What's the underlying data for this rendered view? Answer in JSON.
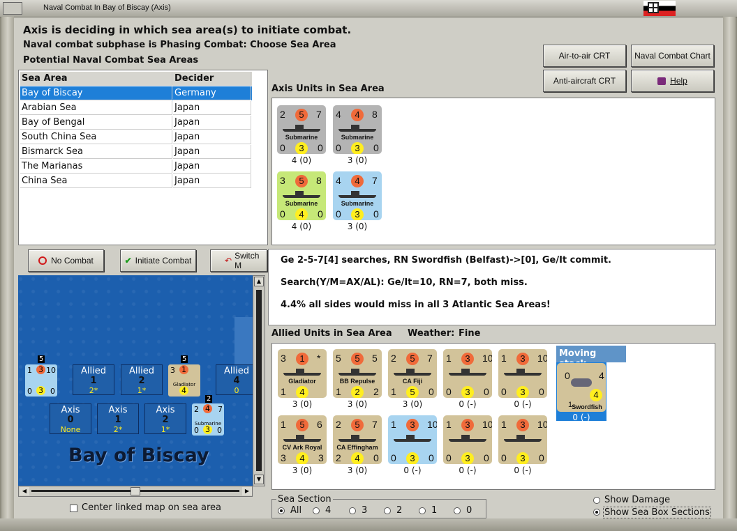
{
  "window": {
    "title": "Naval Combat In Bay of Biscay (Axis)"
  },
  "header": {
    "line1": "Axis is deciding in which sea area(s) to initiate combat.",
    "line2": "Naval combat subphase is Phasing Combat: Choose Sea Area",
    "line3": "Potential Naval Combat Sea Areas"
  },
  "buttons": {
    "air_crt": "Air-to-air CRT",
    "naval_chart": "Naval Combat Chart",
    "aa_crt": "Anti-aircraft CRT",
    "help": "Help",
    "no_combat": "No Combat",
    "initiate": "Initiate Combat",
    "switch": "Switch M"
  },
  "sea_table": {
    "headers": [
      "Sea Area",
      "Decider"
    ],
    "rows": [
      [
        "Bay of Biscay",
        "Germany"
      ],
      [
        "Arabian Sea",
        "Japan"
      ],
      [
        "Bay of Bengal",
        "Japan"
      ],
      [
        "South China Sea",
        "Japan"
      ],
      [
        "Bismarck Sea",
        "Japan"
      ],
      [
        "The Marianas",
        "Japan"
      ],
      [
        "China Sea",
        "Japan"
      ]
    ]
  },
  "axis_panel": {
    "label": "Axis Units in Sea Area",
    "units": [
      {
        "a": "2",
        "b": "5",
        "c": "7",
        "type": "Submarine",
        "d": "0",
        "e": "3",
        "f": "0",
        "under": "4 (0)",
        "color": "#b4b4b4"
      },
      {
        "a": "4",
        "b": "4",
        "c": "8",
        "type": "Submarine",
        "d": "0",
        "e": "3",
        "f": "0",
        "under": "3 (0)",
        "color": "#b4b4b4"
      },
      {
        "a": "3",
        "b": "5",
        "c": "8",
        "type": "Submarine",
        "d": "0",
        "e": "4",
        "f": "0",
        "under": "4 (0)",
        "color": "#c6e878"
      },
      {
        "a": "4",
        "b": "4",
        "c": "7",
        "type": "Submarine",
        "d": "0",
        "e": "3",
        "f": "0",
        "under": "3 (0)",
        "color": "#a8d4f0"
      }
    ]
  },
  "log": {
    "line1": "Ge 2-5-7[4] searches, RN Swordfish (Belfast)->[0], Ge/It commit.",
    "line2": "Search(Y/M=AX/AL):  Ge/It=10, RN=7, both miss.",
    "line3": "4.4% all sides would miss in all 3 Atlantic Sea Areas!"
  },
  "allied_panel": {
    "label": "Allied Units in Sea Area",
    "weather_label": "Weather:",
    "weather": "Fine",
    "units": [
      {
        "a": "3",
        "b": "1",
        "c": "*",
        "type": "Gladiator",
        "d": "1",
        "e": "4",
        "f": "",
        "under": "3 (0)",
        "color": "#d2c39a"
      },
      {
        "a": "5",
        "b": "5",
        "c": "5",
        "type": "BB Repulse",
        "d": "1",
        "e": "2",
        "f": "2",
        "under": "3 (0)",
        "color": "#d2c39a"
      },
      {
        "a": "2",
        "b": "5",
        "c": "7",
        "type": "CA Fiji",
        "d": "1",
        "e": "5",
        "f": "0",
        "under": "3 (0)",
        "color": "#d2c39a"
      },
      {
        "a": "1",
        "b": "3",
        "c": "10",
        "type": "",
        "d": "0",
        "e": "3",
        "f": "0",
        "under": "0 (-)",
        "color": "#d2c39a"
      },
      {
        "a": "1",
        "b": "3",
        "c": "10",
        "type": "",
        "d": "0",
        "e": "3",
        "f": "0",
        "under": "0 (-)",
        "color": "#d2c39a"
      },
      {
        "a": "1",
        "b": "5",
        "c": "6",
        "type": "CV Ark Royal",
        "d": "3",
        "e": "4",
        "f": "3",
        "under": "3 (0)",
        "color": "#d2c39a"
      },
      {
        "a": "2",
        "b": "5",
        "c": "7",
        "type": "CA Effingham",
        "d": "2",
        "e": "4",
        "f": "0",
        "under": "3 (0)",
        "color": "#d2c39a"
      },
      {
        "a": "1",
        "b": "3",
        "c": "10",
        "type": "",
        "d": "0",
        "e": "3",
        "f": "0",
        "under": "0 (-)",
        "color": "#a8d4f0"
      },
      {
        "a": "1",
        "b": "3",
        "c": "10",
        "type": "",
        "d": "0",
        "e": "3",
        "f": "0",
        "under": "0 (-)",
        "color": "#d2c39a"
      },
      {
        "a": "1",
        "b": "3",
        "c": "10",
        "type": "",
        "d": "0",
        "e": "3",
        "f": "0",
        "under": "0 (-)",
        "color": "#d2c39a"
      }
    ]
  },
  "moving_stack": {
    "label": "Moving stack",
    "unit_a": "0",
    "unit_b": "4",
    "unit_c": "4",
    "unit_d": "1",
    "type": "Swordfish",
    "under": "0 (-)"
  },
  "map": {
    "title": "Bay of Biscay",
    "allied_boxes": [
      {
        "label": "Allied",
        "num": "1",
        "sub": "2*"
      },
      {
        "label": "Allied",
        "num": "2",
        "sub": "1*"
      },
      {
        "label": "Allied",
        "num": "4",
        "sub": "0"
      }
    ],
    "axis_boxes": [
      {
        "label": "Axis",
        "num": "0",
        "sub": "None"
      },
      {
        "label": "Axis",
        "num": "1",
        "sub": "2*"
      },
      {
        "label": "Axis",
        "num": "2",
        "sub": "1*"
      }
    ],
    "stack_counts": [
      "5",
      "5",
      "2"
    ],
    "left_counter": {
      "a": "1",
      "b": "3",
      "c": "10",
      "d": "0",
      "e": "3",
      "f": "0"
    },
    "gladiator_counter": {
      "a": "3",
      "b": "1",
      "type": "Gladiator",
      "e": "4"
    },
    "sub_counter": {
      "a": "2",
      "b": "4",
      "c": "7",
      "type": "Submarine",
      "d": "0",
      "e": "3",
      "f": "0"
    }
  },
  "footer": {
    "center_map": "Center linked map on sea area",
    "sea_section_label": "Sea Section",
    "sea_options": [
      "All",
      "4",
      "3",
      "2",
      "1",
      "0"
    ],
    "show_damage": "Show Damage",
    "show_sections": "Show Sea Box Sections"
  },
  "colors": {
    "selection": "#1e7fd8",
    "map_sea": "#1c5fae",
    "orange": "#f06a3a",
    "yellow": "#ffee20"
  }
}
